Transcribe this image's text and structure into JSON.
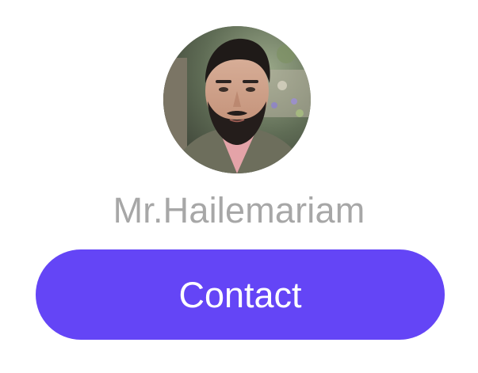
{
  "profile": {
    "name": "Mr.Hailemariam",
    "avatar_alt": "Profile photo"
  },
  "actions": {
    "contact_label": "Contact"
  },
  "colors": {
    "background": "#ffffff",
    "name_text": "#a7a7a7",
    "button_background": "#6445f6",
    "button_text": "#ffffff"
  },
  "icons": {
    "avatar": "person-photo"
  }
}
